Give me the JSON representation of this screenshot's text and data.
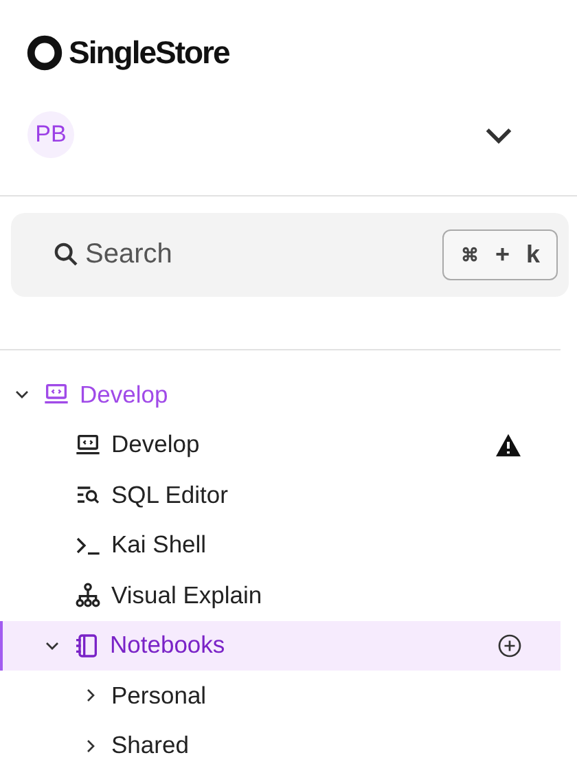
{
  "logo": {
    "text": "SingleStore"
  },
  "account": {
    "initials": "PB",
    "expanded": false
  },
  "search": {
    "placeholder": "Search",
    "shortcut": [
      "⌘",
      "+",
      "k"
    ]
  },
  "nav": {
    "label": "Develop",
    "expanded": true,
    "items": [
      {
        "label": "Develop",
        "selected": false,
        "warning": true,
        "addable": false
      },
      {
        "label": "SQL Editor",
        "selected": false,
        "warning": false,
        "addable": false
      },
      {
        "label": "Kai Shell",
        "selected": false,
        "warning": false,
        "addable": false
      },
      {
        "label": "Visual Explain",
        "selected": false,
        "warning": false,
        "addable": false
      },
      {
        "label": "Notebooks",
        "selected": true,
        "warning": false,
        "addable": true,
        "expanded": true,
        "children": [
          {
            "label": "Personal",
            "expanded": false
          },
          {
            "label": "Shared",
            "expanded": false
          }
        ]
      }
    ]
  }
}
